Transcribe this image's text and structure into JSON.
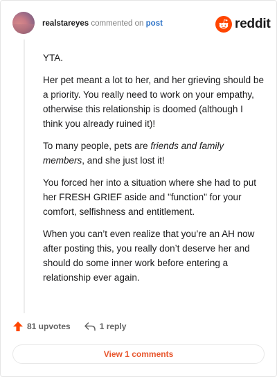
{
  "header": {
    "username": "realstareyes",
    "action": "commented on",
    "post_link": "post",
    "logo_text": "reddit",
    "avatar_icon": "avatar-sunset-image",
    "logo_icon": "reddit-snoo-icon"
  },
  "comment": {
    "p1": "YTA.",
    "p2": "Her pet meant a lot to her, and her grieving should be a priority. You really need to work on your empathy, otherwise this relationship is doomed (although I think you already ruined it)!",
    "p3_before": "To many people, pets are ",
    "p3_italic": "friends and family members",
    "p3_after": ", and she just lost it!",
    "p4": "You forced her into a situation where she had to put her FRESH GRIEF aside and \"function\" for your comfort, selfishness and entitlement.",
    "p5": "When you can’t even realize that you’re an AH now after posting this, you really don’t deserve her and should do some inner work before entering a relationship ever again."
  },
  "actions": {
    "upvotes": "81 upvotes",
    "reply": "1 reply",
    "upvote_icon": "upvote-arrow-icon",
    "reply_icon": "reply-arrow-icon"
  },
  "footer": {
    "view_comments": "View 1 comments"
  },
  "colors": {
    "reddit_orange": "#ff4500",
    "link_blue": "#2d73c7",
    "view_button_text": "#e8562d",
    "muted_text": "#7c7c7c"
  }
}
